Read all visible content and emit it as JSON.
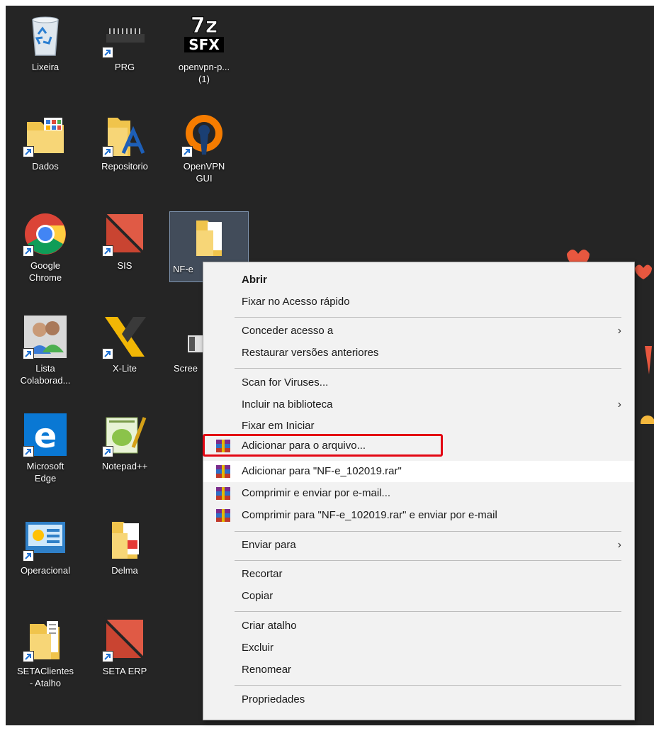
{
  "desktop": {
    "icons": [
      {
        "label": "Lixeira",
        "icon": "recycle-bin-icon"
      },
      {
        "label": "PRG",
        "icon": "chip-icon"
      },
      {
        "label": "openvpn-p...\n(1)",
        "icon": "7z-sfx-icon",
        "logo_text": "7z SFX"
      },
      {
        "label": "Dados",
        "icon": "folder-icon"
      },
      {
        "label": "Repositorio",
        "icon": "folder-icon"
      },
      {
        "label": "OpenVPN\nGUI",
        "icon": "openvpn-icon"
      },
      {
        "label": "Google\nChrome",
        "icon": "chrome-icon"
      },
      {
        "label": "SIS",
        "icon": "sis-icon"
      },
      {
        "label": "NF-e",
        "icon": "folder-icon"
      },
      {
        "label": "Lista\nColaborad...",
        "icon": "users-icon"
      },
      {
        "label": "X-Lite",
        "icon": "x-lite-icon"
      },
      {
        "label": "Scree",
        "icon": "screen-icon"
      },
      {
        "label": "Microsoft\nEdge",
        "icon": "edge-icon"
      },
      {
        "label": "Notepad++",
        "icon": "notepad-plus-plus-icon"
      },
      {
        "label": "Operacional",
        "icon": "operacional-icon"
      },
      {
        "label": "Delma",
        "icon": "pdf-folder-icon"
      },
      {
        "label": "SETAClientes\n- Atalho",
        "icon": "folder-icon"
      },
      {
        "label": "SETA ERP",
        "icon": "seta-erp-icon"
      }
    ]
  },
  "context_menu": {
    "items": [
      {
        "label": "Abrir",
        "bold": true
      },
      {
        "label": "Fixar no Acesso rápido"
      },
      {
        "label": "Conceder acesso a",
        "submenu": true
      },
      {
        "label": "Restaurar versões anteriores"
      },
      {
        "label": "Scan for Viruses..."
      },
      {
        "label": "Incluir na biblioteca",
        "submenu": true
      },
      {
        "label": "Fixar em Iniciar"
      },
      {
        "label": "Adicionar para o arquivo...",
        "icon": "winrar-icon"
      },
      {
        "label": "Adicionar para \"NF-e_102019.rar\"",
        "icon": "winrar-icon",
        "highlighted": true
      },
      {
        "label": "Comprimir e enviar por e-mail...",
        "icon": "winrar-icon"
      },
      {
        "label": "Comprimir para \"NF-e_102019.rar\" e enviar por e-mail",
        "icon": "winrar-icon"
      },
      {
        "label": "Enviar para",
        "submenu": true
      },
      {
        "label": "Recortar"
      },
      {
        "label": "Copiar"
      },
      {
        "label": "Criar atalho"
      },
      {
        "label": "Excluir"
      },
      {
        "label": "Renomear"
      },
      {
        "label": "Propriedades"
      }
    ],
    "submenu_arrow": "›"
  },
  "colors": {
    "desktop_bg": "#252525",
    "menu_bg": "#f2f2f2",
    "highlight_box": "#e30613"
  }
}
